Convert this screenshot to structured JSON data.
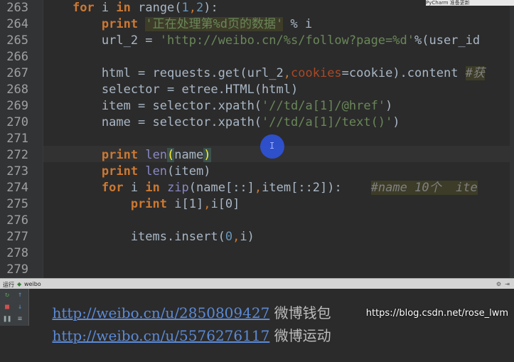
{
  "popup": {
    "text": "PyCharm 准备更新"
  },
  "editor": {
    "current_line": "272",
    "lines": [
      {
        "num": "263",
        "tokens": [
          {
            "t": "    ",
            "c": "plain"
          },
          {
            "t": "for",
            "c": "kw"
          },
          {
            "t": " i ",
            "c": "plain"
          },
          {
            "t": "in",
            "c": "kw"
          },
          {
            "t": " range(",
            "c": "plain"
          },
          {
            "t": "1",
            "c": "num"
          },
          {
            "t": ",",
            "c": "comma"
          },
          {
            "t": "2",
            "c": "num"
          },
          {
            "t": "):",
            "c": "plain"
          }
        ]
      },
      {
        "num": "264",
        "tokens": [
          {
            "t": "        ",
            "c": "plain"
          },
          {
            "t": "print",
            "c": "kw"
          },
          {
            "t": " ",
            "c": "plain"
          },
          {
            "t": "'正在处理第%d页的数据'",
            "c": "strhl"
          },
          {
            "t": " % i",
            "c": "plain"
          }
        ]
      },
      {
        "num": "265",
        "tokens": [
          {
            "t": "        url_2 = ",
            "c": "plain"
          },
          {
            "t": "'http://weibo.cn/%s/follow?page=%d'",
            "c": "str"
          },
          {
            "t": "%(user_id",
            "c": "plain"
          }
        ]
      },
      {
        "num": "266",
        "tokens": []
      },
      {
        "num": "267",
        "tokens": [
          {
            "t": "        html = requests.get(url_2",
            "c": "plain"
          },
          {
            "t": ",",
            "c": "comma"
          },
          {
            "t": "cookies",
            "c": "kwarg"
          },
          {
            "t": "=cookie).content ",
            "c": "plain"
          },
          {
            "t": "#获",
            "c": "cmthl"
          }
        ]
      },
      {
        "num": "268",
        "tokens": [
          {
            "t": "        selector = etree.HTML(html)",
            "c": "plain"
          }
        ]
      },
      {
        "num": "269",
        "tokens": [
          {
            "t": "        item = selector.xpath(",
            "c": "plain"
          },
          {
            "t": "'//td/a[1]/@href'",
            "c": "str"
          },
          {
            "t": ")",
            "c": "plain"
          }
        ]
      },
      {
        "num": "270",
        "tokens": [
          {
            "t": "        name = selector.xpath(",
            "c": "plain"
          },
          {
            "t": "'//td/a[1]/text()'",
            "c": "str"
          },
          {
            "t": ")",
            "c": "plain"
          }
        ]
      },
      {
        "num": "271",
        "tokens": []
      },
      {
        "num": "272",
        "tokens": [
          {
            "t": "        ",
            "c": "plain"
          },
          {
            "t": "print",
            "c": "kw"
          },
          {
            "t": " ",
            "c": "plain"
          },
          {
            "t": "len",
            "c": "bi"
          },
          {
            "t": "(",
            "c": "paren-hl"
          },
          {
            "t": "name",
            "c": "plain"
          },
          {
            "t": ")",
            "c": "paren-hl"
          }
        ]
      },
      {
        "num": "273",
        "tokens": [
          {
            "t": "        ",
            "c": "plain"
          },
          {
            "t": "print",
            "c": "kw"
          },
          {
            "t": " ",
            "c": "plain"
          },
          {
            "t": "len",
            "c": "bi"
          },
          {
            "t": "(item)",
            "c": "plain"
          }
        ]
      },
      {
        "num": "274",
        "tokens": [
          {
            "t": "        ",
            "c": "plain"
          },
          {
            "t": "for",
            "c": "kw"
          },
          {
            "t": " i ",
            "c": "plain"
          },
          {
            "t": "in",
            "c": "kw"
          },
          {
            "t": " ",
            "c": "plain"
          },
          {
            "t": "zip",
            "c": "bi"
          },
          {
            "t": "(name[::]",
            "c": "plain"
          },
          {
            "t": ",",
            "c": "comma"
          },
          {
            "t": "item[::2]):    ",
            "c": "plain"
          },
          {
            "t": "#name 10个  ite",
            "c": "cmthl"
          }
        ]
      },
      {
        "num": "275",
        "tokens": [
          {
            "t": "            ",
            "c": "plain"
          },
          {
            "t": "print",
            "c": "kw"
          },
          {
            "t": " i[1]",
            "c": "plain"
          },
          {
            "t": ",",
            "c": "comma"
          },
          {
            "t": "i[0]",
            "c": "plain"
          }
        ]
      },
      {
        "num": "276",
        "tokens": []
      },
      {
        "num": "277",
        "tokens": [
          {
            "t": "            items.insert(",
            "c": "plain"
          },
          {
            "t": "0",
            "c": "num"
          },
          {
            "t": ",",
            "c": "comma"
          },
          {
            "t": "i)",
            "c": "plain"
          }
        ]
      },
      {
        "num": "278",
        "tokens": []
      },
      {
        "num": "279",
        "tokens": []
      }
    ]
  },
  "run_bar": {
    "label": "运行",
    "config": "weibo"
  },
  "console": {
    "lines": [
      {
        "url": "http://weibo.cn/u/2850809427",
        "text": " 微博钱包"
      },
      {
        "url": "http://weibo.cn/u/5576276117",
        "text": " 微博运动"
      }
    ]
  },
  "watermark": "https://blog.csdn.net/rose_lwm",
  "colors": {
    "keyword": "#cc7832",
    "string": "#6a8759",
    "number": "#6897bb",
    "background": "#2b2b2b"
  }
}
